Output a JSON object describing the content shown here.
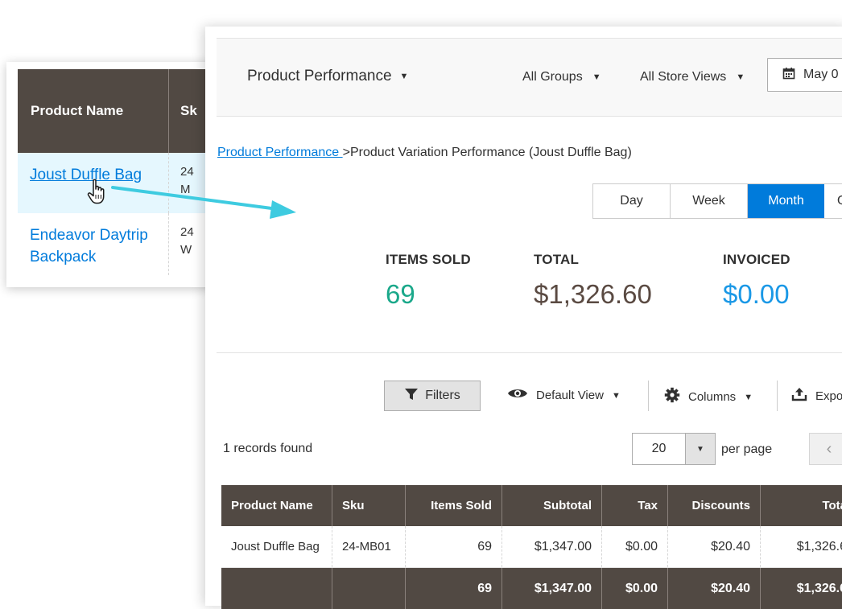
{
  "background_table": {
    "headers": [
      "Product Name",
      "Sk"
    ],
    "rows": [
      {
        "name": "Joust Duffle Bag",
        "sku": "24\nM"
      },
      {
        "name_line1": "Endeavor Daytrip",
        "name_line2": "Backpack",
        "sku": "24\nW"
      }
    ]
  },
  "header": {
    "report_title": "Product Performance",
    "groups_dropdown": "All Groups",
    "store_views_dropdown": "All Store Views",
    "date_button": "May 0"
  },
  "breadcrumb": {
    "link": "Product Performance ",
    "separator": ">",
    "current": "Product Variation Performance (Joust Duffle Bag)"
  },
  "period_tabs": {
    "day": "Day",
    "week": "Week",
    "month": "Month",
    "more": "Q"
  },
  "stats": {
    "items_sold_label": "ITEMS SOLD",
    "items_sold_value": "69",
    "total_label": "TOTAL",
    "total_value": "$1,326.60",
    "invoiced_label": "INVOICED",
    "invoiced_value": "$0.00"
  },
  "toolbar": {
    "filters": "Filters",
    "default_view": "Default View",
    "columns": "Columns",
    "export": "Expo"
  },
  "pagination": {
    "records_found": "1 records found",
    "per_page_value": "20",
    "per_page_label": "per page"
  },
  "grid": {
    "headers": {
      "product_name": "Product Name",
      "sku": "Sku",
      "items_sold": "Items Sold",
      "subtotal": "Subtotal",
      "tax": "Tax",
      "discounts": "Discounts",
      "total": "Tota"
    },
    "row": {
      "product_name": "Joust Duffle Bag",
      "sku": "24-MB01",
      "items_sold": "69",
      "subtotal": "$1,347.00",
      "tax": "$0.00",
      "discounts": "$20.40",
      "total": "$1,326.6"
    },
    "totals": {
      "items_sold": "69",
      "subtotal": "$1,347.00",
      "tax": "$0.00",
      "discounts": "$20.40",
      "total": "$1,326.6"
    }
  },
  "colors": {
    "header_bg": "#514943",
    "link_blue": "#007bdb",
    "items_sold_teal": "#1aa88a",
    "total_brown": "#5a4a42",
    "invoiced_blue": "#1a98e6",
    "arrow_cyan": "#3ecbe0"
  },
  "icons": {
    "date": "calendar-icon",
    "filters": "funnel-icon",
    "view": "eye-icon",
    "columns": "gear-icon",
    "export": "upload-icon",
    "prev": "chevron-left-icon",
    "cursor": "hand-pointer-icon"
  }
}
